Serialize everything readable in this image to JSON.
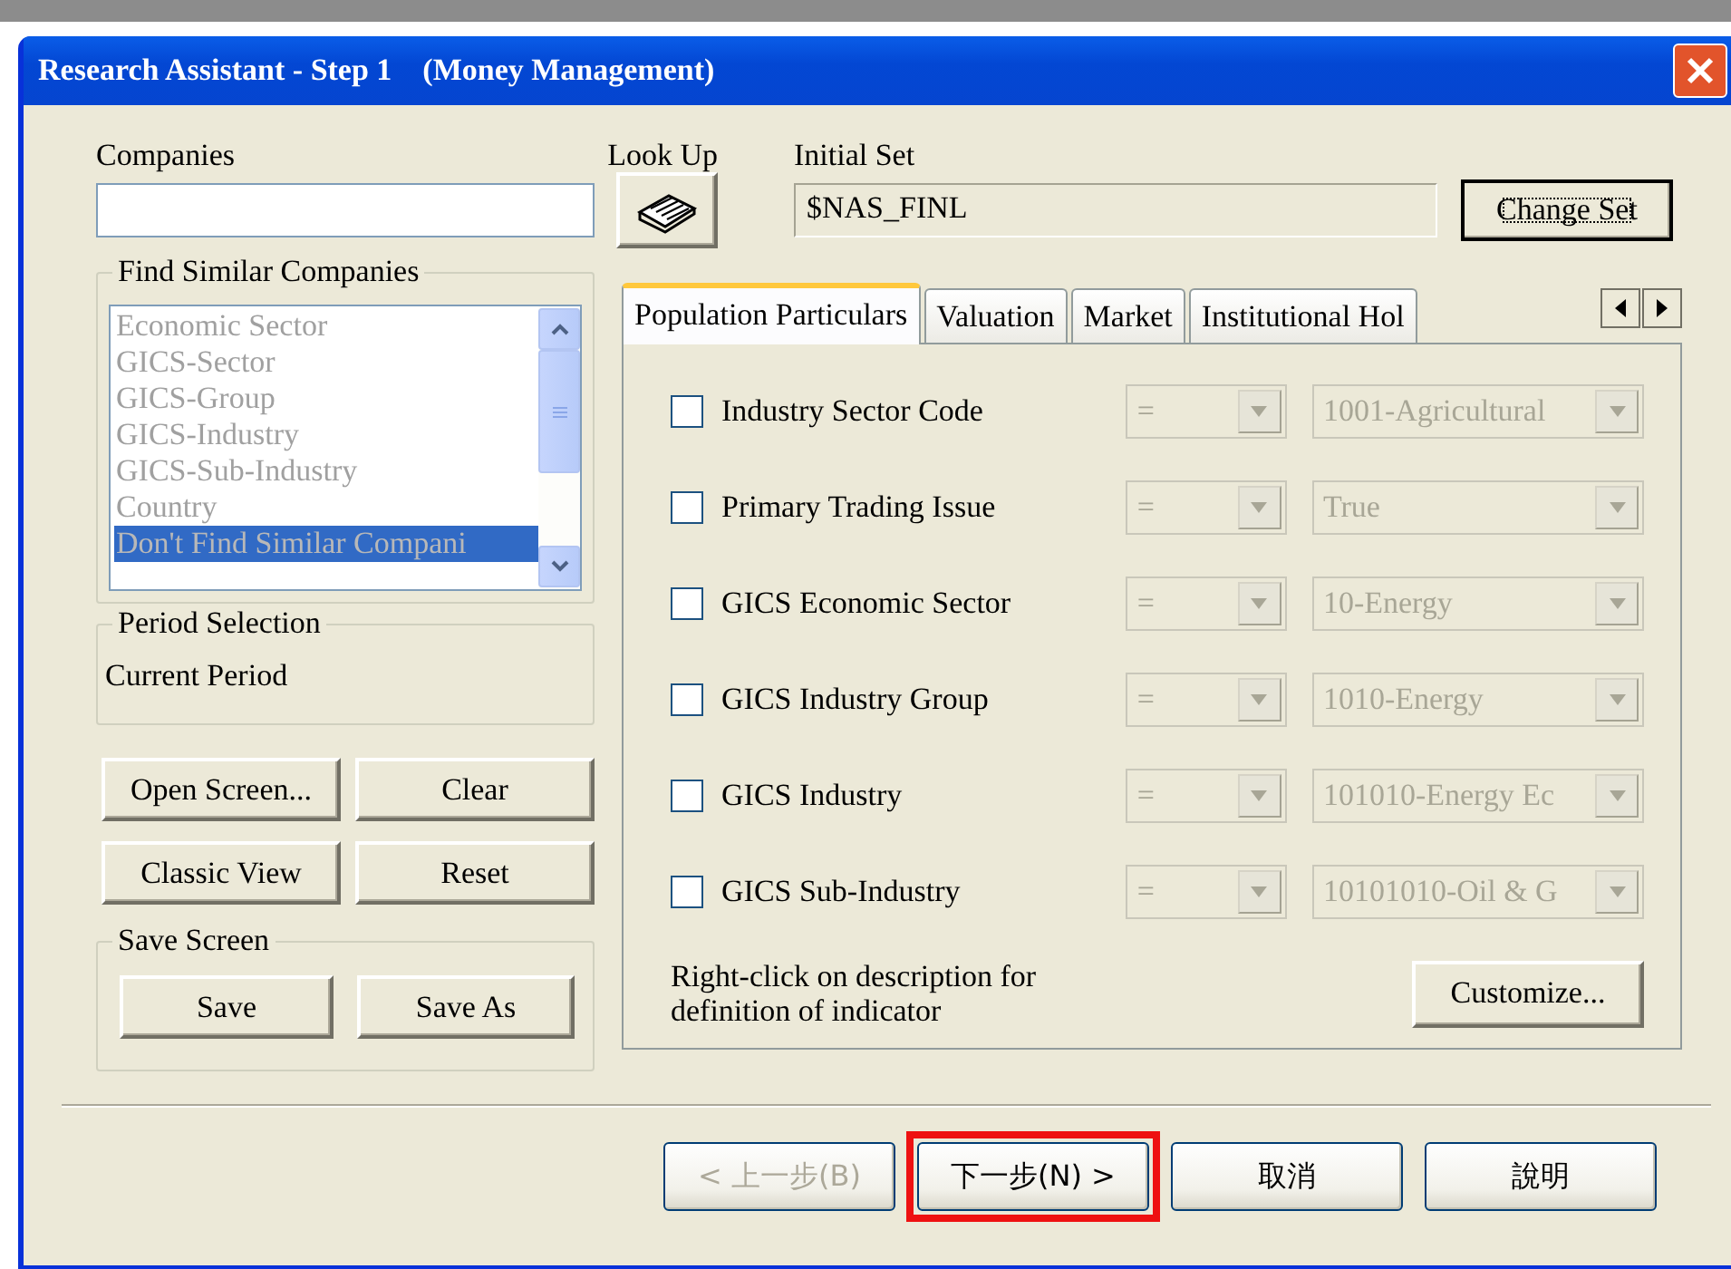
{
  "window": {
    "title": "Research Assistant - Step 1    (Money Management)"
  },
  "companies": {
    "label": "Companies"
  },
  "look_up": {
    "label": "Look Up"
  },
  "initial_set": {
    "label": "Initial Set",
    "value": "$NAS_FINL"
  },
  "change_set_button": {
    "label": "Change Set",
    "focused": true
  },
  "find_similar": {
    "title": "Find Similar Companies",
    "disabled": true,
    "items": [
      {
        "label": "Economic Sector",
        "selected": false
      },
      {
        "label": "GICS-Sector",
        "selected": false
      },
      {
        "label": "GICS-Group",
        "selected": false
      },
      {
        "label": "GICS-Industry",
        "selected": false
      },
      {
        "label": "GICS-Sub-Industry",
        "selected": false
      },
      {
        "label": "Country",
        "selected": false
      },
      {
        "label": "Don't Find Similar Compani",
        "selected": true
      }
    ]
  },
  "period_selection": {
    "title": "Period Selection",
    "value": "Current Period"
  },
  "buttons": [
    "Open Screen...",
    "Clear",
    "Classic View",
    "Reset"
  ],
  "save_screen": {
    "title": "Save Screen",
    "buttons": [
      "Save",
      "Save As"
    ]
  },
  "tabs": [
    {
      "label": "Population Particulars",
      "selected": true
    },
    {
      "label": "Valuation",
      "selected": false
    },
    {
      "label": "Market",
      "selected": false
    },
    {
      "label": "Institutional Hol",
      "selected": false
    }
  ],
  "criteria": [
    {
      "label": "Industry Sector Code",
      "checked": false,
      "disabled": true,
      "operator": "=",
      "value": "1001-Agricultural"
    },
    {
      "label": "Primary Trading Issue",
      "checked": false,
      "disabled": true,
      "operator": "=",
      "value": "True"
    },
    {
      "label": "GICS Economic Sector",
      "checked": false,
      "disabled": true,
      "operator": "=",
      "value": "10-Energy"
    },
    {
      "label": "GICS Industry Group",
      "checked": false,
      "disabled": true,
      "operator": "=",
      "value": "1010-Energy"
    },
    {
      "label": "GICS Industry",
      "checked": false,
      "disabled": true,
      "operator": "=",
      "value": "101010-Energy Ec"
    },
    {
      "label": "GICS Sub-Industry",
      "checked": false,
      "disabled": true,
      "operator": "=",
      "value": "10101010-Oil & G"
    }
  ],
  "note": "Right-click on description for definition of indicator",
  "customize_button": "Customize...",
  "footer_buttons": [
    {
      "label": "< 上一步(B)",
      "disabled": true,
      "highlighted": false
    },
    {
      "label": "下一步(N) >",
      "disabled": false,
      "highlighted": true
    },
    {
      "label": "取消",
      "disabled": false,
      "highlighted": false
    },
    {
      "label": "說明",
      "disabled": false,
      "highlighted": false
    }
  ]
}
